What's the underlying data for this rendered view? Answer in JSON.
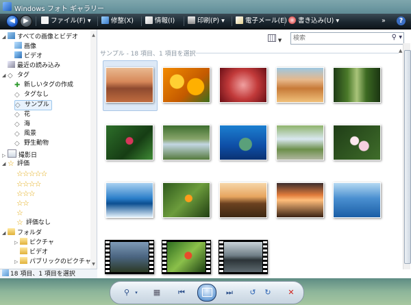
{
  "window": {
    "title": "Windows フォト ギャラリー"
  },
  "toolbar": {
    "file": "ファイル(F)",
    "fix": "修整(X)",
    "info": "情報(I)",
    "print": "印刷(P)",
    "email": "電子メール(E)",
    "burn": "書き込み(U)",
    "more": "»",
    "help": "?"
  },
  "search": {
    "placeholder": "検索"
  },
  "group": {
    "header": "サンプル - 18 項目、1 項目を選択"
  },
  "sidebar": {
    "all": "すべての画像とビデオ",
    "pictures": "画像",
    "videos": "ビデオ",
    "recent": "最近の読み込み",
    "tags": "タグ",
    "create_tag": "新しいタグの作成",
    "no_tag": "タグなし",
    "sample": "サンプル",
    "flower": "花",
    "sea": "海",
    "landscape": "風景",
    "wildlife": "野生動物",
    "date_taken": "撮影日",
    "rating": "評価",
    "no_rating": "評価なし",
    "folders": "フォルダ",
    "folder_pictures": "ピクチャ",
    "folder_videos": "ビデオ",
    "folder_public": "パブリックのピクチャ"
  },
  "ratings": [
    "☆☆☆☆☆",
    "☆☆☆☆",
    "☆☆☆",
    "☆☆",
    "☆"
  ],
  "status": {
    "text": "18 項目、1 項目を選択"
  },
  "colors": {
    "toolbar": "#1b2730",
    "selection": "#dde9f7",
    "accent": "#1f5fd0"
  }
}
